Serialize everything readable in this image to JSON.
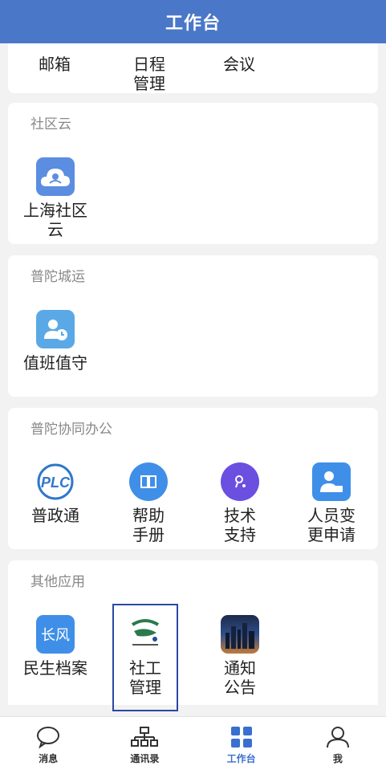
{
  "header": {
    "title": "工作台"
  },
  "top_row": {
    "items": [
      "邮箱",
      "日程\n管理",
      "会议"
    ]
  },
  "sections": [
    {
      "title": "社区云",
      "apps": [
        {
          "label": "上海社区\n云",
          "icon": "cloud-community-icon"
        }
      ]
    },
    {
      "title": "普陀城运",
      "apps": [
        {
          "label": "值班值守",
          "icon": "person-clock-icon"
        }
      ]
    },
    {
      "title": "普陀协同办公",
      "apps": [
        {
          "label": "普政通",
          "icon": "putuo-logo-icon"
        },
        {
          "label": "帮助\n手册",
          "icon": "book-icon"
        },
        {
          "label": "技术\n支持",
          "icon": "support-icon"
        },
        {
          "label": "人员变\n更申请",
          "icon": "person-change-icon"
        }
      ]
    },
    {
      "title": "其他应用",
      "apps": [
        {
          "label": "民生档案",
          "icon": "changfeng-icon",
          "icon_text": "长风"
        },
        {
          "label": "社工\n管理",
          "icon": "social-work-logo-icon"
        },
        {
          "label": "通知\n公告",
          "icon": "city-photo-icon"
        }
      ]
    }
  ],
  "tabbar": {
    "items": [
      {
        "label": "消息",
        "icon": "chat-icon"
      },
      {
        "label": "通讯录",
        "icon": "org-chart-icon"
      },
      {
        "label": "工作台",
        "icon": "grid-icon",
        "active": true
      },
      {
        "label": "我",
        "icon": "user-icon"
      }
    ]
  },
  "colors": {
    "header": "#4a77c8",
    "accent": "#3a6fd0"
  }
}
